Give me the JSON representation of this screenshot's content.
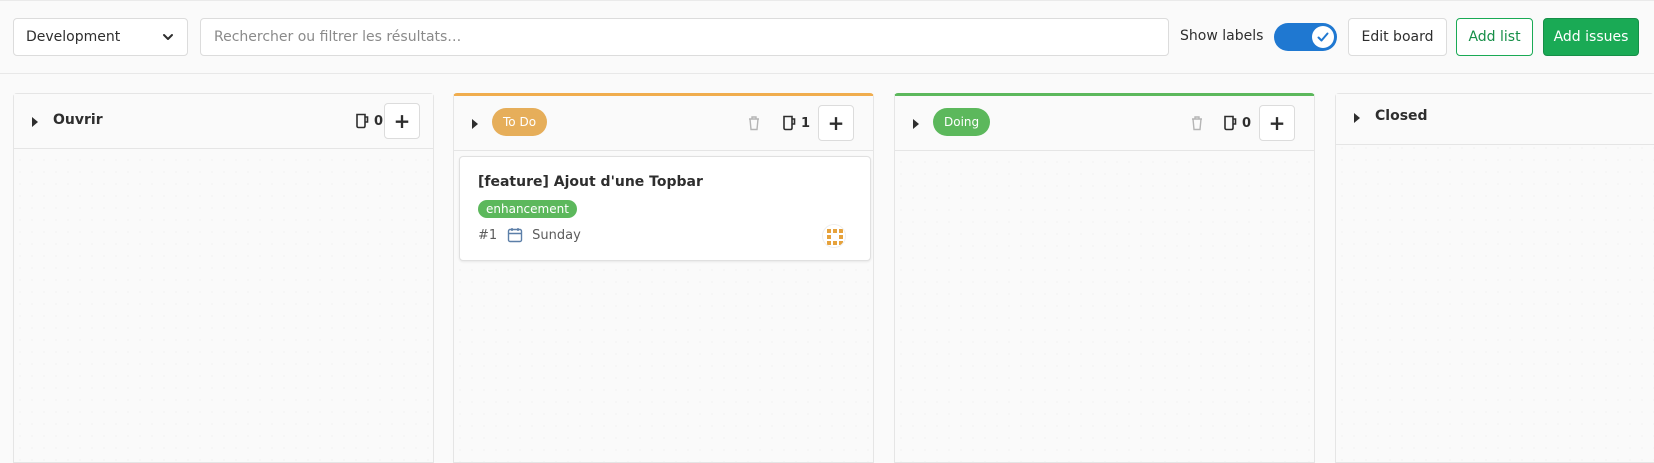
{
  "toolbar": {
    "board_select": "Development",
    "search_placeholder": "Rechercher ou filtrer les résultats…",
    "show_labels": "Show labels",
    "show_labels_on": true,
    "edit_board": "Edit board",
    "add_list": "Add list",
    "add_issues": "Add issues"
  },
  "lists": [
    {
      "title": "Ouvrir",
      "count": "0",
      "add": "+"
    },
    {
      "title": "To Do",
      "count": "1",
      "add": "+",
      "color": "#e6ae5a",
      "card": {
        "title": "[feature] Ajout d'une Topbar",
        "label": "enhancement",
        "label_color": "#5cb85c",
        "number": "#1",
        "due": "Sunday"
      }
    },
    {
      "title": "Doing",
      "count": "0",
      "add": "+",
      "color": "#5cb85c"
    },
    {
      "title": "Closed"
    }
  ],
  "colors": {
    "accent": "#1f78d1",
    "primary_green": "#1aaa55"
  }
}
